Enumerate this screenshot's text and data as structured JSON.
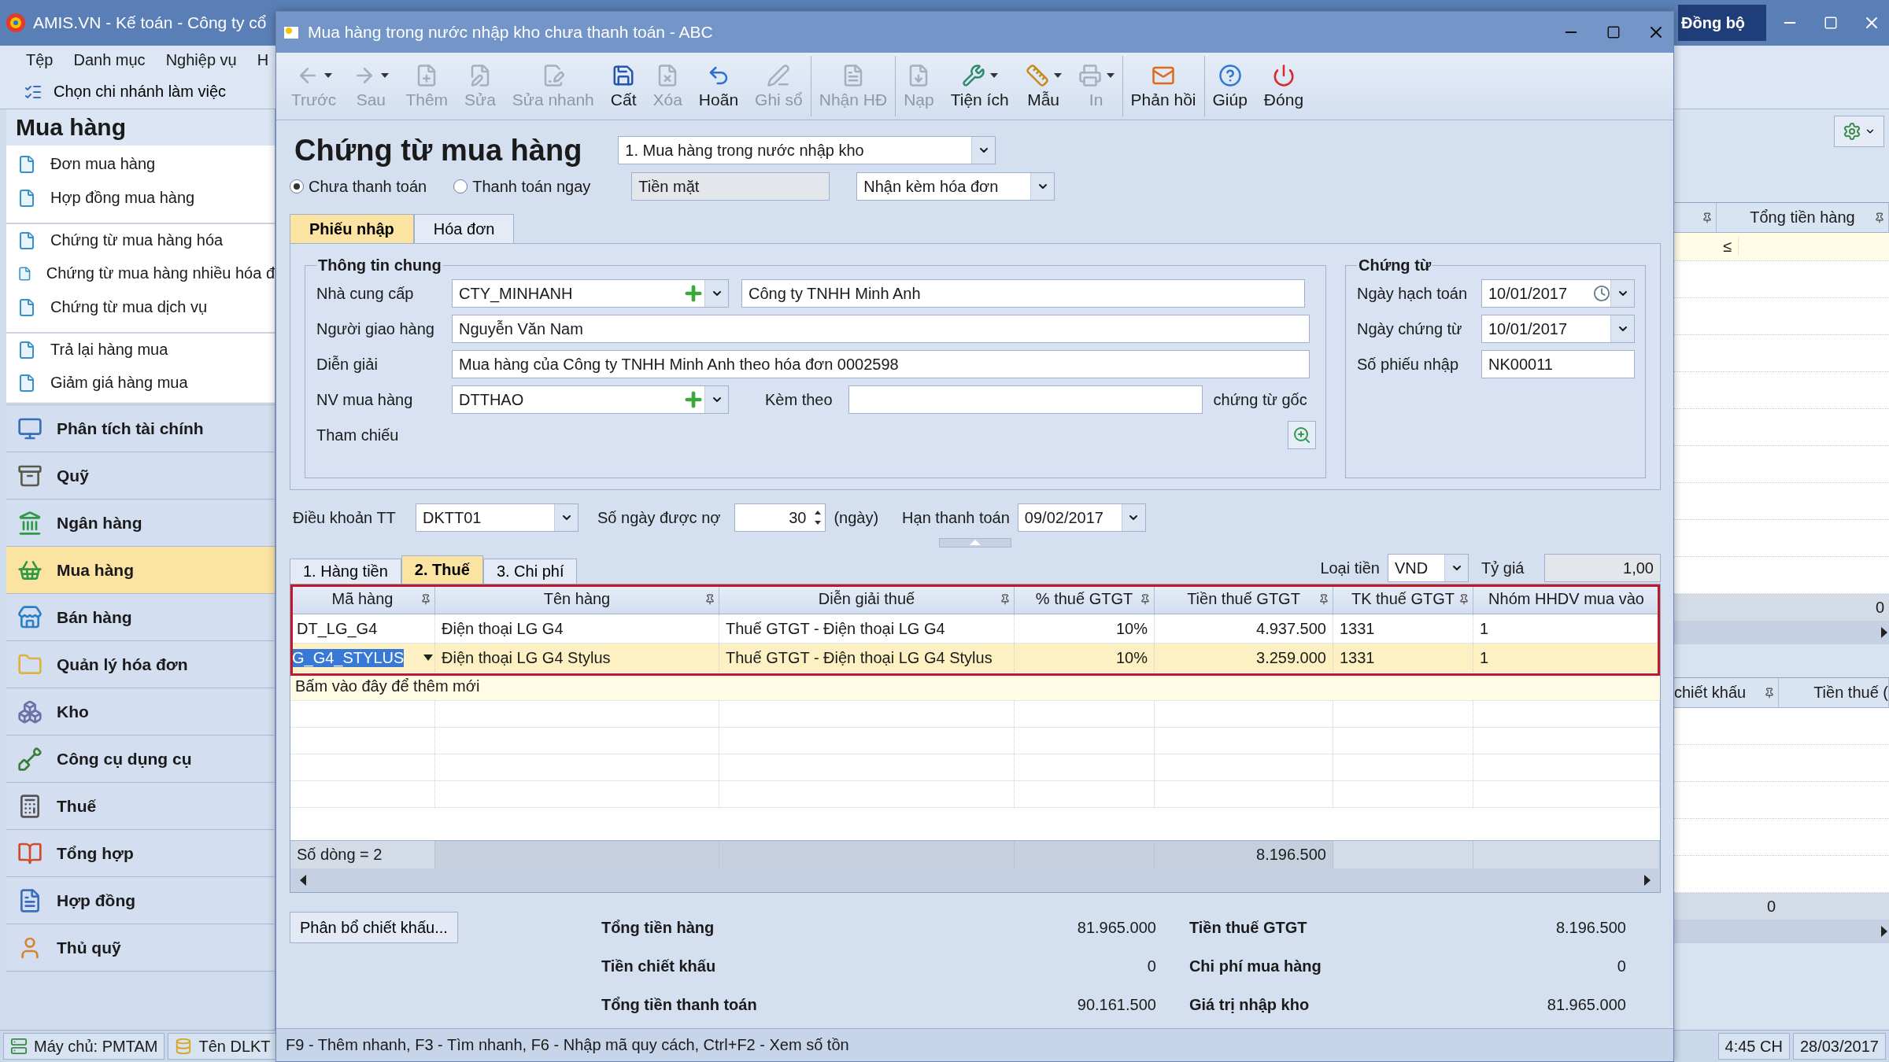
{
  "main_window": {
    "title": "AMIS.VN - Kế toán - Công ty cổ",
    "sync_button": "Đồng bộ",
    "menu": [
      {
        "label": "Tệp"
      },
      {
        "label": "Danh mục"
      },
      {
        "label": "Nghiệp vụ"
      },
      {
        "label": "H"
      }
    ],
    "branch_button": "Chọn chi nhánh làm việc"
  },
  "sidebar": {
    "title": "Mua hàng",
    "links": [
      {
        "label": "Đơn mua hàng",
        "divider_before": false
      },
      {
        "label": "Hợp đồng mua hàng",
        "divider_before": false
      },
      {
        "label": "Chứng từ mua hàng hóa",
        "divider_before": true
      },
      {
        "label": "Chứng từ mua hàng nhiều hóa đ",
        "divider_before": false
      },
      {
        "label": "Chứng từ mua dịch vụ",
        "divider_before": false
      },
      {
        "label": "Trả lại hàng mua",
        "divider_before": true
      },
      {
        "label": "Giảm giá hàng mua",
        "divider_before": false
      }
    ],
    "modules": [
      {
        "label": "Phân tích tài chính",
        "selected": false
      },
      {
        "label": "Quỹ",
        "selected": false
      },
      {
        "label": "Ngân hàng",
        "selected": false
      },
      {
        "label": "Mua hàng",
        "selected": true
      },
      {
        "label": "Bán hàng",
        "selected": false
      },
      {
        "label": "Quản lý hóa đơn",
        "selected": false
      },
      {
        "label": "Kho",
        "selected": false
      },
      {
        "label": "Công cụ dụng cụ",
        "selected": false
      },
      {
        "label": "Thuế",
        "selected": false
      },
      {
        "label": "Tổng hợp",
        "selected": false
      },
      {
        "label": "Hợp đồng",
        "selected": false
      },
      {
        "label": "Thủ quỹ",
        "selected": false
      }
    ]
  },
  "upper_grid": {
    "column": "Tổng tiền hàng",
    "filter": "≤",
    "total": "0"
  },
  "lower_grid": {
    "columns": [
      "chiết khấu",
      "Tiền thuế ("
    ],
    "total": "0"
  },
  "status_bar": {
    "server": "Máy chủ: PMTAM",
    "database": "Tên DLKT",
    "time": "4:45 CH",
    "date": "28/03/2017"
  },
  "dialog": {
    "title": "Mua hàng trong nước nhập kho chưa thanh toán - ABC",
    "toolbar": [
      {
        "label": "Trước",
        "disabled": true,
        "caret": true,
        "separator_before": false
      },
      {
        "label": "Sau",
        "disabled": true,
        "caret": true,
        "separator_before": false
      },
      {
        "label": "Thêm",
        "disabled": true,
        "caret": false,
        "separator_before": false
      },
      {
        "label": "Sửa",
        "disabled": true,
        "caret": false,
        "separator_before": false
      },
      {
        "label": "Sửa nhanh",
        "disabled": true,
        "caret": false,
        "separator_before": false
      },
      {
        "label": "Cất",
        "disabled": false,
        "caret": false,
        "separator_before": false
      },
      {
        "label": "Xóa",
        "disabled": true,
        "caret": false,
        "separator_before": false
      },
      {
        "label": "Hoãn",
        "disabled": false,
        "caret": false,
        "separator_before": false
      },
      {
        "label": "Ghi sổ",
        "disabled": true,
        "caret": false,
        "separator_before": false
      },
      {
        "label": "Nhận HĐ",
        "disabled": true,
        "caret": false,
        "separator_before": true
      },
      {
        "label": "Nạp",
        "disabled": true,
        "caret": false,
        "separator_before": true
      },
      {
        "label": "Tiện ích",
        "disabled": false,
        "caret": true,
        "separator_before": false
      },
      {
        "label": "Mẫu",
        "disabled": false,
        "caret": true,
        "separator_before": false
      },
      {
        "label": "In",
        "disabled": true,
        "caret": true,
        "separator_before": false
      },
      {
        "label": "Phản hồi",
        "disabled": false,
        "caret": false,
        "separator_before": true
      },
      {
        "label": "Giúp",
        "disabled": false,
        "caret": false,
        "separator_before": true
      },
      {
        "label": "Đóng",
        "disabled": false,
        "caret": false,
        "separator_before": false
      }
    ],
    "heading": "Chứng từ mua hàng",
    "voucher_type": "1. Mua hàng trong nước nhập kho",
    "payment_options": [
      {
        "label": "Chưa thanh toán",
        "selected": true
      },
      {
        "label": "Thanh toán ngay",
        "selected": false
      }
    ],
    "payment_method": {
      "value": "Tiền mặt",
      "disabled": true
    },
    "invoice_option": "Nhận kèm hóa đơn",
    "tabs": [
      {
        "label": "Phiếu nhập",
        "selected": true
      },
      {
        "label": "Hóa đơn",
        "selected": false
      }
    ],
    "general_info": {
      "title": "Thông tin chung",
      "supplier": {
        "label": "Nhà cung cấp",
        "code": "CTY_MINHANH",
        "name": "Công ty TNHH Minh Anh"
      },
      "deliverer": {
        "label": "Người giao hàng",
        "value": "Nguyễn Văn Nam"
      },
      "description": {
        "label": "Diễn giải",
        "value": "Mua hàng của Công ty TNHH Minh Anh theo hóa đơn 0002598"
      },
      "buyer": {
        "label": "NV mua hàng",
        "code": "DTTHAO"
      },
      "attachments": {
        "label": "Kèm theo",
        "suffix": "chứng từ gốc"
      },
      "reference": {
        "label": "Tham chiếu"
      }
    },
    "voucher_info": {
      "title": "Chứng từ",
      "posting_date": {
        "label": "Ngày hạch toán",
        "value": "10/01/2017"
      },
      "voucher_date": {
        "label": "Ngày chứng từ",
        "value": "10/01/2017"
      },
      "receipt_no": {
        "label": "Số phiếu nhập",
        "value": "NK00011"
      }
    },
    "terms": {
      "label": "Điều khoản TT",
      "value": "DKTT01"
    },
    "credit_days": {
      "label": "Số ngày được nợ",
      "value": "30",
      "unit": "(ngày)"
    },
    "due_date": {
      "label": "Hạn thanh toán",
      "value": "09/02/2017"
    },
    "grid_tabs": [
      {
        "label": "1. Hàng tiền",
        "selected": false
      },
      {
        "label": "2. Thuế",
        "selected": true
      },
      {
        "label": "3. Chi phí",
        "selected": false
      }
    ],
    "currency": {
      "label": "Loại tiền",
      "value": "VND"
    },
    "exchange_rate": {
      "label": "Tỷ giá",
      "value": "1,00"
    },
    "table": {
      "outlined": true,
      "columns": [
        {
          "label": "Mã hàng",
          "right_aligned": false,
          "summed": false
        },
        {
          "label": "Tên hàng",
          "right_aligned": false,
          "summed": false
        },
        {
          "label": "Diễn giải thuế",
          "right_aligned": false,
          "summed": false
        },
        {
          "label": "% thuế GTGT",
          "right_aligned": true,
          "summed": false
        },
        {
          "label": "Tiền thuế GTGT",
          "right_aligned": true,
          "summed": true
        },
        {
          "label": "TK thuế GTGT",
          "right_aligned": false,
          "summed": false
        },
        {
          "label": "Nhóm HHDV mua vào",
          "right_aligned": false,
          "summed": false
        }
      ],
      "rows": [
        {
          "selected": false,
          "cells": [
            "DT_LG_G4",
            "Điện thoại LG G4",
            "Thuế GTGT - Điện thoại LG G4",
            "10%",
            "4.937.500",
            "1331",
            "1"
          ]
        },
        {
          "selected": true,
          "cells": [
            "G_G4_STYLUS",
            "Điện thoại LG G4 Stylus",
            "Thuế GTGT - Điện thoại LG G4 Stylus",
            "10%",
            "3.259.000",
            "1331",
            "1"
          ]
        }
      ],
      "add_row_hint": "Bấm vào đây để thêm mới",
      "row_count": "Số dòng = 2",
      "total": "8.196.500"
    },
    "allocate_button": "Phân bổ chiết khấu...",
    "totals": [
      {
        "label": "Tổng tiền hàng",
        "value": "81.965.000"
      },
      {
        "label": "Tiền chiết khấu",
        "value": "0"
      },
      {
        "label": "Tổng tiền thanh toán",
        "value": "90.161.500"
      },
      {
        "label": "Tiền thuế GTGT",
        "value": "8.196.500"
      },
      {
        "label": "Chi phí mua hàng",
        "value": "0"
      },
      {
        "label": "Giá trị nhập kho",
        "value": "81.965.000"
      }
    ],
    "hint": "F9 - Thêm nhanh, F3 - Tìm nhanh, F6 - Nhập mã quy cách, Ctrl+F2 - Xem số tồn"
  }
}
